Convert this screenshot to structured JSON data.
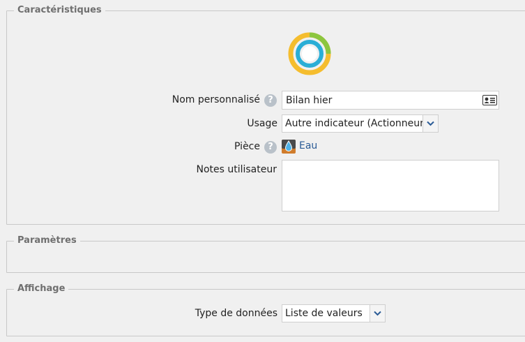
{
  "sections": {
    "caracteristiques": {
      "legend": "Caractéristiques"
    },
    "parametres": {
      "legend": "Paramètres"
    },
    "affichage": {
      "legend": "Affichage"
    }
  },
  "form": {
    "nom": {
      "label": "Nom personnalisé",
      "value": "Bilan hier",
      "help": "?"
    },
    "usage": {
      "label": "Usage",
      "value": "Autre indicateur (Actionneur)"
    },
    "piece": {
      "label": "Pièce",
      "value": "Eau",
      "help": "?"
    },
    "notes": {
      "label": "Notes utilisateur",
      "value": ""
    },
    "type": {
      "label": "Type de données",
      "value": "Liste de valeurs"
    }
  },
  "icons": {
    "device": "ring-indicator-icon",
    "card": "id-card-icon",
    "room": "water-drop-icon"
  },
  "colors": {
    "ring_yellow": "#f5bd2e",
    "ring_green": "#8cc63f",
    "ring_blue": "#2aaed6",
    "link": "#2a5b96"
  }
}
